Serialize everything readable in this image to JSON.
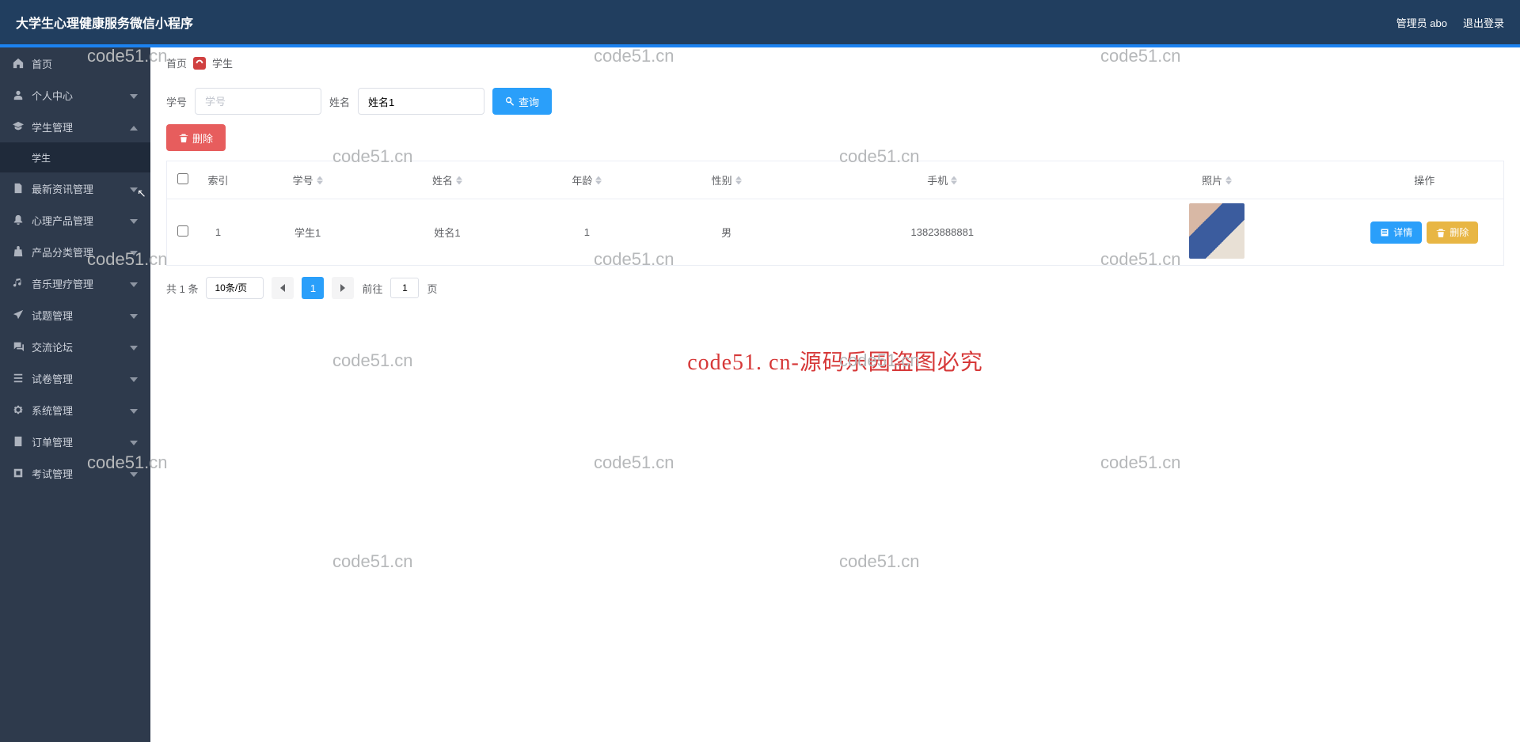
{
  "header": {
    "title": "大学生心理健康服务微信小程序",
    "admin": "管理员 abo",
    "logout": "退出登录"
  },
  "sidebar": {
    "items": [
      {
        "icon": "home",
        "label": "首页",
        "chev": null
      },
      {
        "icon": "user",
        "label": "个人中心",
        "chev": "down"
      },
      {
        "icon": "grad",
        "label": "学生管理",
        "chev": "up",
        "open": true,
        "children": [
          {
            "label": "学生"
          }
        ]
      },
      {
        "icon": "doc",
        "label": "最新资讯管理",
        "chev": "down"
      },
      {
        "icon": "bell",
        "label": "心理产品管理",
        "chev": "down"
      },
      {
        "icon": "bag",
        "label": "产品分类管理",
        "chev": "down"
      },
      {
        "icon": "music",
        "label": "音乐理疗管理",
        "chev": "down"
      },
      {
        "icon": "plane",
        "label": "试题管理",
        "chev": "down"
      },
      {
        "icon": "forum",
        "label": "交流论坛",
        "chev": "down"
      },
      {
        "icon": "list",
        "label": "试卷管理",
        "chev": "down"
      },
      {
        "icon": "system",
        "label": "系统管理",
        "chev": "down"
      },
      {
        "icon": "order",
        "label": "订单管理",
        "chev": "down"
      },
      {
        "icon": "exam",
        "label": "考试管理",
        "chev": "down"
      }
    ]
  },
  "breadcrumb": {
    "home": "首页",
    "current": "学生"
  },
  "search": {
    "label1": "学号",
    "placeholder1": "学号",
    "label2": "姓名",
    "value2": "姓名1",
    "queryBtn": "查询"
  },
  "batch": {
    "deleteBtn": "删除"
  },
  "table": {
    "headers": {
      "index": "索引",
      "sid": "学号",
      "name": "姓名",
      "age": "年龄",
      "gender": "性别",
      "phone": "手机",
      "photo": "照片",
      "op": "操作"
    },
    "rows": [
      {
        "index": "1",
        "sid": "学生1",
        "name": "姓名1",
        "age": "1",
        "gender": "男",
        "phone": "13823888881"
      }
    ],
    "detailBtn": "详情",
    "deleteBtn": "删除"
  },
  "pagination": {
    "total": "共 1 条",
    "pageSize": "10条/页",
    "goto": "前往",
    "pageVal": "1",
    "pageUnit": "页"
  },
  "watermarks": {
    "text": "code51.cn",
    "red": "code51. cn-源码乐园盗图必究"
  }
}
